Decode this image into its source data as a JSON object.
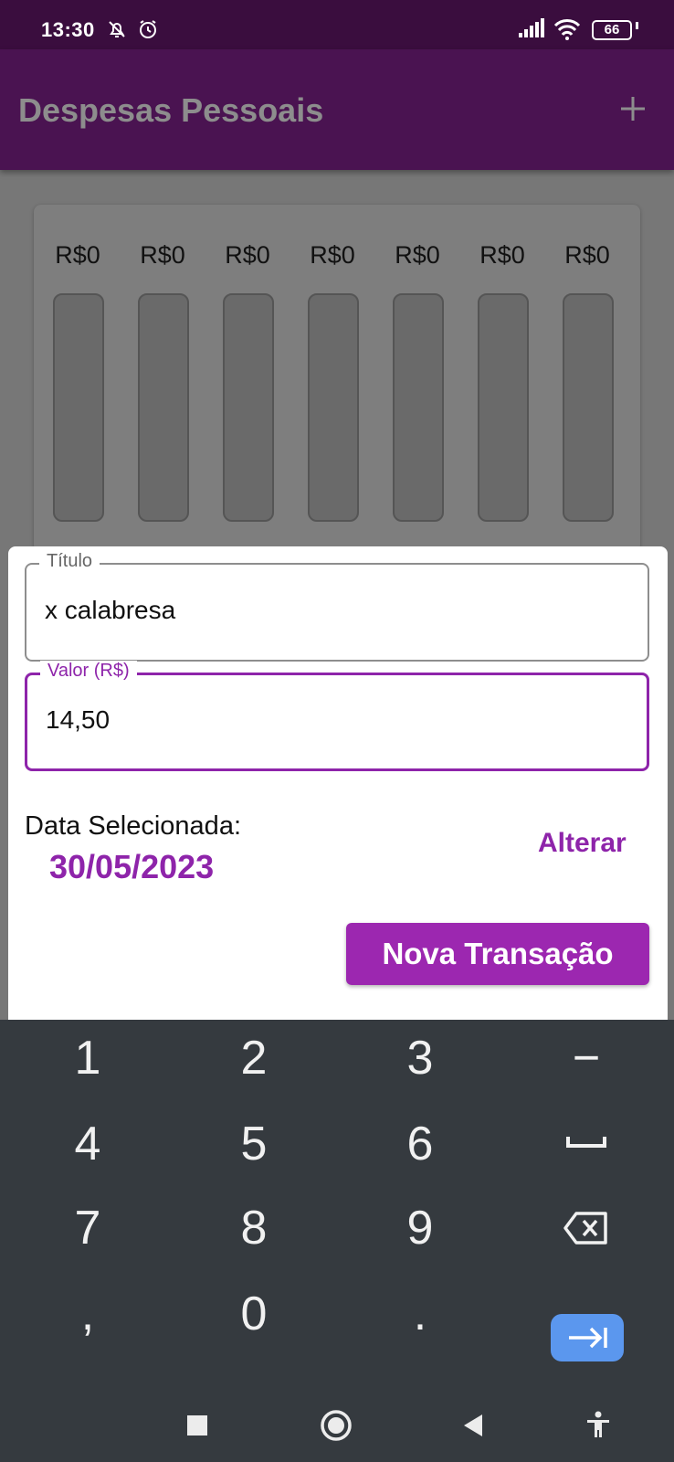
{
  "status": {
    "time": "13:30",
    "battery": "66",
    "icons": [
      "bell-off-icon",
      "alarm-icon",
      "signal-icon",
      "wifi-icon",
      "battery-icon"
    ]
  },
  "app": {
    "title": "Despesas Pessoais",
    "add_icon": "plus-icon"
  },
  "chart": {
    "labels": [
      "R$0",
      "R$0",
      "R$0",
      "R$0",
      "R$0",
      "R$0",
      "R$0"
    ],
    "fills": [
      0,
      0,
      0,
      0,
      0,
      0,
      0
    ]
  },
  "form": {
    "title_label": "Título",
    "title_value": "x calabresa",
    "value_label": "Valor (R$)",
    "value_value": "14,50",
    "date_label": "Data Selecionada:",
    "date_value": "30/05/2023",
    "change_label": "Alterar",
    "submit_label": "Nova Transação"
  },
  "keyboard": {
    "rows": [
      [
        "1",
        "2",
        "3",
        "−"
      ],
      [
        "4",
        "5",
        "6",
        "space-icon"
      ],
      [
        "7",
        "8",
        "9",
        "backspace-icon"
      ],
      [
        ",",
        "0",
        ".",
        "tab-icon"
      ]
    ]
  },
  "navbar": {
    "items": [
      "recent-apps-icon",
      "home-icon",
      "back-icon",
      "accessibility-icon"
    ]
  },
  "colors": {
    "accent": "#9c27b0",
    "appbar": "#4a1351",
    "statusbar": "#3a0d3e",
    "keyboard": "#353a3f",
    "tab_key": "#5b97ee"
  }
}
